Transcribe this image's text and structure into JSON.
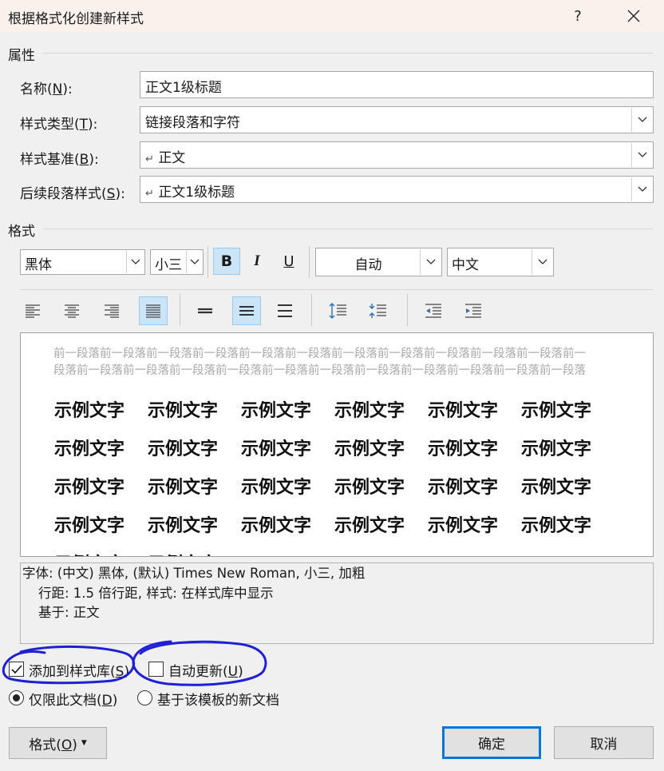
{
  "window": {
    "title": "根据格式化创建新样式",
    "help": "?",
    "close": "✕"
  },
  "properties": {
    "section_label": "属性",
    "name_label": "名称",
    "name_key": "N",
    "name_value": "正文1级标题",
    "type_label": "样式类型",
    "type_key": "T",
    "type_value": "链接段落和字符",
    "base_label": "样式基准",
    "base_key": "B",
    "base_value": "正文",
    "next_label": "后续段落样式",
    "next_key": "S",
    "next_value": "正文1级标题",
    "para_mark": "↵"
  },
  "format": {
    "section_label": "格式",
    "font": "黑体",
    "size": "小三",
    "bold": "B",
    "italic": "I",
    "underline": "U",
    "color": "自动",
    "script": "中文"
  },
  "preview": {
    "prev_paragraph": "前一段落前一段落前一段落前一段落前一段落前一段落前一段落前一段落前一段落前一段落前一段落前一段落前一段落前一段落前一段落前一段落前一段落前一段落前一段落前一段落前一段落前一段落前一段落",
    "sample": "示例文字"
  },
  "description": {
    "line1": "字体: (中文) 黑体, (默认) Times New Roman, 小三, 加粗",
    "line2": "行距: 1.5 倍行距, 样式: 在样式库中显示",
    "line3": "基于: 正文"
  },
  "options": {
    "add_to_gallery": "添加到样式库",
    "add_to_gallery_key": "S",
    "add_to_gallery_checked": true,
    "auto_update": "自动更新",
    "auto_update_key": "U",
    "auto_update_checked": false,
    "only_this_doc": "仅限此文档",
    "only_this_doc_key": "D",
    "only_this_doc_selected": true,
    "new_docs": "基于该模板的新文档",
    "new_docs_selected": false
  },
  "buttons": {
    "format": "格式",
    "format_key": "O",
    "ok": "确定",
    "cancel": "取消"
  },
  "colors": {
    "title_bg": "#fbf1ec",
    "accent": "#0078d7",
    "active_tool": "#cce4f7",
    "ink": "#1f1fd6"
  }
}
